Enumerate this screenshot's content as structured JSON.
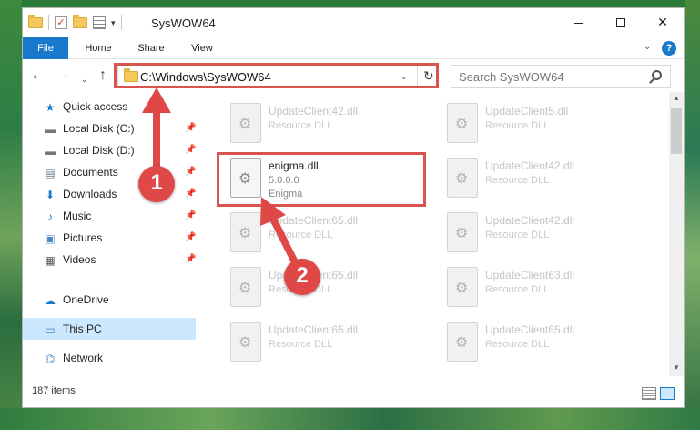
{
  "window": {
    "title": "SysWOW64",
    "controls": {
      "minimize": "—",
      "maximize": "",
      "close": "✕"
    }
  },
  "ribbon": {
    "tabs": [
      "File",
      "Home",
      "Share",
      "View"
    ],
    "expand": "⌄",
    "help": "?"
  },
  "nav": {
    "back": "←",
    "forward": "→",
    "recent": "⌄",
    "up": "↑",
    "address": "C:\\Windows\\SysWOW64",
    "address_drop": "⌄",
    "refresh": "↻",
    "search_placeholder": "Search SysWOW64"
  },
  "sidebar": {
    "quick_access": "Quick access",
    "items": [
      {
        "label": "Local Disk (C:)",
        "icon": "drive-icon",
        "glyph": "▬",
        "pinned": true
      },
      {
        "label": "Local Disk (D:)",
        "icon": "drive-icon",
        "glyph": "▬",
        "pinned": true
      },
      {
        "label": "Documents",
        "icon": "documents-icon",
        "glyph": "▤",
        "pinned": true
      },
      {
        "label": "Downloads",
        "icon": "downloads-icon",
        "glyph": "⬇",
        "pinned": true
      },
      {
        "label": "Music",
        "icon": "music-icon",
        "glyph": "♪",
        "pinned": true
      },
      {
        "label": "Pictures",
        "icon": "pictures-icon",
        "glyph": "▣",
        "pinned": true
      },
      {
        "label": "Videos",
        "icon": "videos-icon",
        "glyph": "▦",
        "pinned": true
      }
    ],
    "onedrive": "OneDrive",
    "this_pc": "This PC",
    "network": "Network",
    "pin_glyph": "📌"
  },
  "files": [
    {
      "name": "UpdateClient42.dll",
      "type": "Resource DLL"
    },
    {
      "name": "UpdateClient5.dll",
      "type": "Resource DLL"
    },
    {
      "name": "enigma.dll",
      "type": "5.0.0.0",
      "company": "Enigma",
      "active": true
    },
    {
      "name": "UpdateClient42.dll",
      "type": "Resource DLL"
    },
    {
      "name": "UpdateClient65.dll",
      "type": "Resource DLL"
    },
    {
      "name": "UpdateClient42.dll",
      "type": "Resource DLL"
    },
    {
      "name": "UpdateClient65.dll",
      "type": "Resource DLL"
    },
    {
      "name": "UpdateClient63.dll",
      "type": "Resource DLL"
    },
    {
      "name": "UpdateClient65.dll",
      "type": "Resource DLL"
    },
    {
      "name": "UpdateClient65.dll",
      "type": "Resource DLL"
    }
  ],
  "status": {
    "item_count": "187 items"
  },
  "annotations": {
    "step1": "1",
    "step2": "2",
    "color": "#e04848"
  }
}
